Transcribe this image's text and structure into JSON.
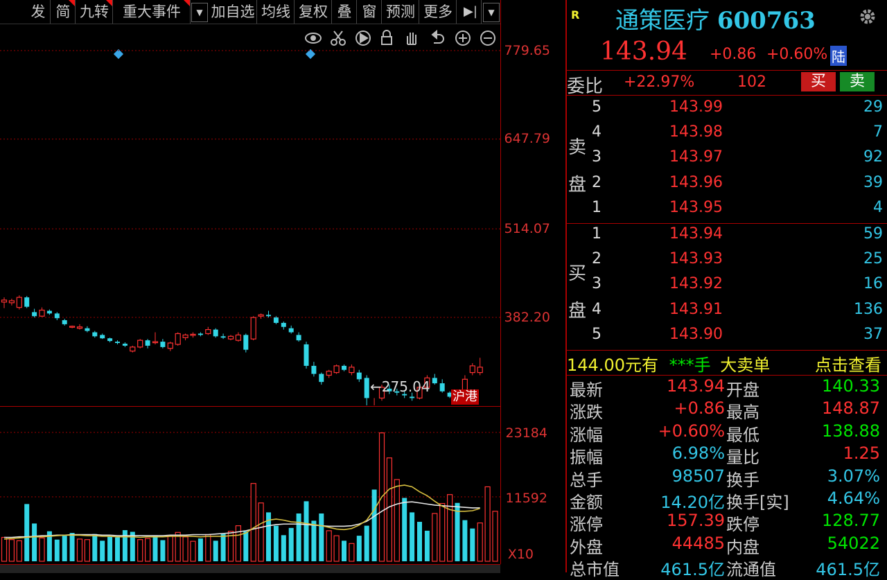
{
  "toolbar": {
    "items": [
      "发",
      "简",
      "九转",
      "重大事件",
      "加自选",
      "均线",
      "复权",
      "叠",
      "窗",
      "预测",
      "更多"
    ],
    "drop_arrow": "▼",
    "end_icon": "▶|"
  },
  "tools_icons": [
    "eye-icon",
    "scissors-icon",
    "play-icon",
    "lock-icon",
    "hand-icon",
    "undo-icon",
    "zoom-in-icon",
    "zoom-out-icon"
  ],
  "price_axis": [
    "779.65",
    "647.79",
    "514.07",
    "382.20"
  ],
  "volume_axis": [
    "23184",
    "11592",
    "X10"
  ],
  "low_marker": "←275.04",
  "hk_tag": "沪港",
  "header": {
    "r_badge": "R",
    "stock_name": "通策医疗",
    "stock_code": "600763",
    "price": "143.94",
    "change": "+0.86",
    "change_pct": "+0.60%",
    "lu_badge": "陆"
  },
  "weibi": {
    "label": "委比",
    "pct": "+22.97%",
    "diff": "102",
    "buy_btn": "买",
    "sell_btn": "卖"
  },
  "sell_labels": [
    "卖",
    "盘"
  ],
  "buy_labels": [
    "买",
    "盘"
  ],
  "sell_orders": [
    {
      "level": "5",
      "price": "143.99",
      "qty": "29"
    },
    {
      "level": "4",
      "price": "143.98",
      "qty": "7"
    },
    {
      "level": "3",
      "price": "143.97",
      "qty": "92"
    },
    {
      "level": "2",
      "price": "143.96",
      "qty": "39"
    },
    {
      "level": "1",
      "price": "143.95",
      "qty": "4"
    }
  ],
  "buy_orders": [
    {
      "level": "1",
      "price": "143.94",
      "qty": "59"
    },
    {
      "level": "2",
      "price": "143.93",
      "qty": "25"
    },
    {
      "level": "3",
      "price": "143.92",
      "qty": "16"
    },
    {
      "level": "4",
      "price": "143.91",
      "qty": "136"
    },
    {
      "level": "5",
      "price": "143.90",
      "qty": "37"
    }
  ],
  "big_order": {
    "price": "144.00",
    "yuan_you": "元有",
    "stars": "***手",
    "big_sell": "大卖单",
    "click_view": "点击查看"
  },
  "stats": [
    {
      "l1": "最新",
      "v1": "143.94",
      "c1": "red",
      "l2": "开盘",
      "v2": "140.33",
      "c2": "green"
    },
    {
      "l1": "涨跌",
      "v1": "+0.86",
      "c1": "red",
      "l2": "最高",
      "v2": "148.87",
      "c2": "red"
    },
    {
      "l1": "涨幅",
      "v1": "+0.60%",
      "c1": "red",
      "l2": "最低",
      "v2": "138.88",
      "c2": "green"
    },
    {
      "l1": "振幅",
      "v1": "6.98%",
      "c1": "cyan",
      "l2": "量比",
      "v2": "1.25",
      "c2": "red"
    },
    {
      "l1": "总手",
      "v1": "98507",
      "c1": "cyan",
      "l2": "换手",
      "v2": "3.07%",
      "c2": "cyan"
    },
    {
      "l1": "金额",
      "v1": "14.20亿",
      "c1": "cyan",
      "l2": "换手[实]",
      "v2": "4.64%",
      "c2": "cyan"
    },
    {
      "l1": "涨停",
      "v1": "157.39",
      "c1": "red",
      "l2": "跌停",
      "v2": "128.77",
      "c2": "green"
    },
    {
      "l1": "外盘",
      "v1": "44485",
      "c1": "red",
      "l2": "内盘",
      "v2": "54022",
      "c2": "green"
    },
    {
      "l1": "总市值",
      "v1": "461.5亿",
      "c1": "cyan",
      "l2": "流通值",
      "v2": "461.5亿",
      "c2": "cyan"
    }
  ],
  "colors": {
    "up": "#ff3232",
    "down": "#33d6e6",
    "axis": "#dd3333",
    "grid": "#a00000",
    "ma_yellow": "#d8c040",
    "ma_white": "#e8e8e8"
  },
  "chart_data": {
    "type": "candlestick",
    "price_ylim": [
      275.04,
      779.65
    ],
    "candles": [
      {
        "o": 405,
        "h": 412,
        "l": 396,
        "c": 408,
        "up": true
      },
      {
        "o": 404,
        "h": 410,
        "l": 400,
        "c": 407,
        "up": true
      },
      {
        "o": 397,
        "h": 415,
        "l": 394,
        "c": 412,
        "up": true
      },
      {
        "o": 412,
        "h": 414,
        "l": 396,
        "c": 398,
        "up": false
      },
      {
        "o": 390,
        "h": 395,
        "l": 382,
        "c": 384,
        "up": false
      },
      {
        "o": 384,
        "h": 397,
        "l": 383,
        "c": 393,
        "up": true
      },
      {
        "o": 392,
        "h": 394,
        "l": 386,
        "c": 388,
        "up": false
      },
      {
        "o": 388,
        "h": 390,
        "l": 378,
        "c": 381,
        "up": false
      },
      {
        "o": 378,
        "h": 380,
        "l": 370,
        "c": 372,
        "up": false
      },
      {
        "o": 368,
        "h": 370,
        "l": 366,
        "c": 369,
        "up": true
      },
      {
        "o": 366,
        "h": 372,
        "l": 364,
        "c": 368,
        "up": true
      },
      {
        "o": 366,
        "h": 369,
        "l": 360,
        "c": 362,
        "up": false
      },
      {
        "o": 360,
        "h": 362,
        "l": 352,
        "c": 354,
        "up": false
      },
      {
        "o": 356,
        "h": 358,
        "l": 350,
        "c": 351,
        "up": false
      },
      {
        "o": 351,
        "h": 352,
        "l": 345,
        "c": 347,
        "up": false
      },
      {
        "o": 346,
        "h": 348,
        "l": 342,
        "c": 344,
        "up": false
      },
      {
        "o": 343,
        "h": 345,
        "l": 338,
        "c": 340,
        "up": false
      },
      {
        "o": 332,
        "h": 340,
        "l": 330,
        "c": 338,
        "up": true
      },
      {
        "o": 338,
        "h": 350,
        "l": 336,
        "c": 348,
        "up": true
      },
      {
        "o": 348,
        "h": 350,
        "l": 336,
        "c": 340,
        "up": false
      },
      {
        "o": 345,
        "h": 360,
        "l": 342,
        "c": 346,
        "up": true
      },
      {
        "o": 346,
        "h": 350,
        "l": 336,
        "c": 338,
        "up": false
      },
      {
        "o": 336,
        "h": 346,
        "l": 332,
        "c": 344,
        "up": true
      },
      {
        "o": 342,
        "h": 360,
        "l": 340,
        "c": 358,
        "up": true
      },
      {
        "o": 352,
        "h": 358,
        "l": 348,
        "c": 356,
        "up": true
      },
      {
        "o": 356,
        "h": 360,
        "l": 352,
        "c": 357,
        "up": true
      },
      {
        "o": 358,
        "h": 360,
        "l": 354,
        "c": 356,
        "up": false
      },
      {
        "o": 358,
        "h": 368,
        "l": 356,
        "c": 364,
        "up": true
      },
      {
        "o": 364,
        "h": 366,
        "l": 352,
        "c": 354,
        "up": false
      },
      {
        "o": 352,
        "h": 358,
        "l": 350,
        "c": 354,
        "up": false
      },
      {
        "o": 350,
        "h": 356,
        "l": 348,
        "c": 354,
        "up": true
      },
      {
        "o": 348,
        "h": 360,
        "l": 346,
        "c": 356,
        "up": true
      },
      {
        "o": 356,
        "h": 358,
        "l": 330,
        "c": 334,
        "up": false
      },
      {
        "o": 350,
        "h": 384,
        "l": 348,
        "c": 382,
        "up": true
      },
      {
        "o": 384,
        "h": 388,
        "l": 380,
        "c": 386,
        "up": true
      },
      {
        "o": 386,
        "h": 392,
        "l": 382,
        "c": 384,
        "up": false
      },
      {
        "o": 382,
        "h": 384,
        "l": 372,
        "c": 374,
        "up": false
      },
      {
        "o": 374,
        "h": 376,
        "l": 364,
        "c": 368,
        "up": false
      },
      {
        "o": 366,
        "h": 370,
        "l": 358,
        "c": 360,
        "up": false
      },
      {
        "o": 356,
        "h": 360,
        "l": 346,
        "c": 348,
        "up": false
      },
      {
        "o": 342,
        "h": 346,
        "l": 306,
        "c": 310,
        "up": false
      },
      {
        "o": 310,
        "h": 316,
        "l": 294,
        "c": 298,
        "up": false
      },
      {
        "o": 298,
        "h": 300,
        "l": 282,
        "c": 286,
        "up": false
      },
      {
        "o": 296,
        "h": 304,
        "l": 292,
        "c": 302,
        "up": true
      },
      {
        "o": 300,
        "h": 312,
        "l": 298,
        "c": 310,
        "up": true
      },
      {
        "o": 310,
        "h": 312,
        "l": 302,
        "c": 304,
        "up": false
      },
      {
        "o": 300,
        "h": 312,
        "l": 296,
        "c": 308,
        "up": true
      },
      {
        "o": 300,
        "h": 304,
        "l": 286,
        "c": 290,
        "up": false
      },
      {
        "o": 292,
        "h": 296,
        "l": 250,
        "c": 262,
        "up": false
      },
      {
        "o": 248,
        "h": 262,
        "l": 230,
        "c": 250,
        "up": true
      },
      {
        "o": 262,
        "h": 282,
        "l": 258,
        "c": 278,
        "up": true
      },
      {
        "o": 276,
        "h": 282,
        "l": 268,
        "c": 272,
        "up": false
      },
      {
        "o": 272,
        "h": 276,
        "l": 266,
        "c": 270,
        "up": false
      },
      {
        "o": 268,
        "h": 272,
        "l": 262,
        "c": 266,
        "up": false
      },
      {
        "o": 264,
        "h": 270,
        "l": 258,
        "c": 262,
        "up": false
      },
      {
        "o": 262,
        "h": 280,
        "l": 260,
        "c": 278,
        "up": true
      },
      {
        "o": 278,
        "h": 296,
        "l": 276,
        "c": 292,
        "up": true
      },
      {
        "o": 292,
        "h": 298,
        "l": 282,
        "c": 284,
        "up": false
      },
      {
        "o": 284,
        "h": 290,
        "l": 270,
        "c": 272,
        "up": false
      },
      {
        "o": 270,
        "h": 272,
        "l": 262,
        "c": 264,
        "up": false
      },
      {
        "o": 266,
        "h": 270,
        "l": 262,
        "c": 264,
        "up": false
      },
      {
        "o": 262,
        "h": 296,
        "l": 258,
        "c": 290,
        "up": true
      },
      {
        "o": 300,
        "h": 314,
        "l": 296,
        "c": 310,
        "up": true
      },
      {
        "o": 300,
        "h": 322,
        "l": 296,
        "c": 308,
        "up": true
      }
    ],
    "volumes": [
      {
        "v": 4300,
        "up": true
      },
      {
        "v": 3900,
        "up": true
      },
      {
        "v": 3700,
        "up": true
      },
      {
        "v": 10300,
        "up": false
      },
      {
        "v": 6800,
        "up": false
      },
      {
        "v": 4200,
        "up": true
      },
      {
        "v": 5400,
        "up": false
      },
      {
        "v": 3900,
        "up": false
      },
      {
        "v": 4600,
        "up": false
      },
      {
        "v": 5100,
        "up": false
      },
      {
        "v": 4000,
        "up": true
      },
      {
        "v": 3900,
        "up": true
      },
      {
        "v": 4900,
        "up": false
      },
      {
        "v": 3700,
        "up": false
      },
      {
        "v": 4500,
        "up": false
      },
      {
        "v": 4300,
        "up": false
      },
      {
        "v": 5600,
        "up": false
      },
      {
        "v": 5300,
        "up": false
      },
      {
        "v": 3900,
        "up": true
      },
      {
        "v": 4100,
        "up": true
      },
      {
        "v": 4600,
        "up": false
      },
      {
        "v": 3800,
        "up": false
      },
      {
        "v": 4600,
        "up": true
      },
      {
        "v": 5200,
        "up": true
      },
      {
        "v": 4400,
        "up": true
      },
      {
        "v": 3600,
        "up": true
      },
      {
        "v": 4100,
        "up": false
      },
      {
        "v": 4800,
        "up": true
      },
      {
        "v": 3700,
        "up": false
      },
      {
        "v": 4900,
        "up": false
      },
      {
        "v": 5400,
        "up": true
      },
      {
        "v": 6400,
        "up": true
      },
      {
        "v": 5400,
        "up": false
      },
      {
        "v": 14000,
        "up": true
      },
      {
        "v": 10500,
        "up": true
      },
      {
        "v": 8800,
        "up": false
      },
      {
        "v": 6400,
        "up": false
      },
      {
        "v": 4700,
        "up": false
      },
      {
        "v": 6000,
        "up": false
      },
      {
        "v": 8600,
        "up": false
      },
      {
        "v": 10800,
        "up": false
      },
      {
        "v": 7300,
        "up": false
      },
      {
        "v": 8600,
        "up": false
      },
      {
        "v": 5500,
        "up": true
      },
      {
        "v": 4600,
        "up": true
      },
      {
        "v": 3700,
        "up": false
      },
      {
        "v": 3200,
        "up": true
      },
      {
        "v": 4600,
        "up": false
      },
      {
        "v": 6400,
        "up": false
      },
      {
        "v": 12900,
        "up": false
      },
      {
        "v": 23100,
        "up": true
      },
      {
        "v": 18600,
        "up": true
      },
      {
        "v": 14700,
        "up": true
      },
      {
        "v": 11400,
        "up": false
      },
      {
        "v": 8800,
        "up": false
      },
      {
        "v": 7100,
        "up": false
      },
      {
        "v": 5500,
        "up": false
      },
      {
        "v": 8600,
        "up": true
      },
      {
        "v": 10400,
        "up": true
      },
      {
        "v": 12000,
        "up": true
      },
      {
        "v": 10500,
        "up": false
      },
      {
        "v": 7400,
        "up": false
      },
      {
        "v": 5900,
        "up": false
      },
      {
        "v": 6900,
        "up": true
      },
      {
        "v": 13400,
        "up": true
      },
      {
        "v": 9000,
        "up": true
      }
    ],
    "volume_ylim": [
      0,
      23184
    ],
    "ma_yellow": [
      4000,
      4100,
      4200,
      4300,
      4400,
      4400,
      4500,
      4600,
      4700,
      4700,
      4700,
      4600,
      4600,
      4500,
      4500,
      4400,
      4400,
      4400,
      4300,
      4400,
      4400,
      4400,
      4500,
      4500,
      4500,
      4500,
      4400,
      4500,
      4500,
      4500,
      4600,
      4700,
      5100,
      6000,
      6800,
      7400,
      7600,
      7400,
      7100,
      7000,
      6800,
      6600,
      6400,
      6100,
      5800,
      5700,
      5900,
      6500,
      7400,
      9300,
      11600,
      13000,
      13500,
      13700,
      13400,
      12500,
      11800,
      10800,
      9900,
      9300,
      9000,
      9000,
      9100,
      9500
    ],
    "ma_white": [
      4300,
      4300,
      4400,
      4400,
      4500,
      4600,
      4600,
      4700,
      4700,
      4800,
      4800,
      4800,
      4800,
      4700,
      4700,
      4600,
      4600,
      4600,
      4600,
      4600,
      4600,
      4600,
      4700,
      4700,
      4700,
      4800,
      4800,
      4800,
      4900,
      5000,
      5100,
      5300,
      5500,
      5800,
      6100,
      6400,
      6600,
      6700,
      6700,
      6700,
      6600,
      6500,
      6400,
      6300,
      6300,
      6300,
      6400,
      6700,
      7200,
      8100,
      9000,
      9800,
      10300,
      10600,
      10700,
      10500,
      10300,
      10100,
      10000,
      9900,
      9800,
      9700,
      9600,
      9600
    ]
  }
}
